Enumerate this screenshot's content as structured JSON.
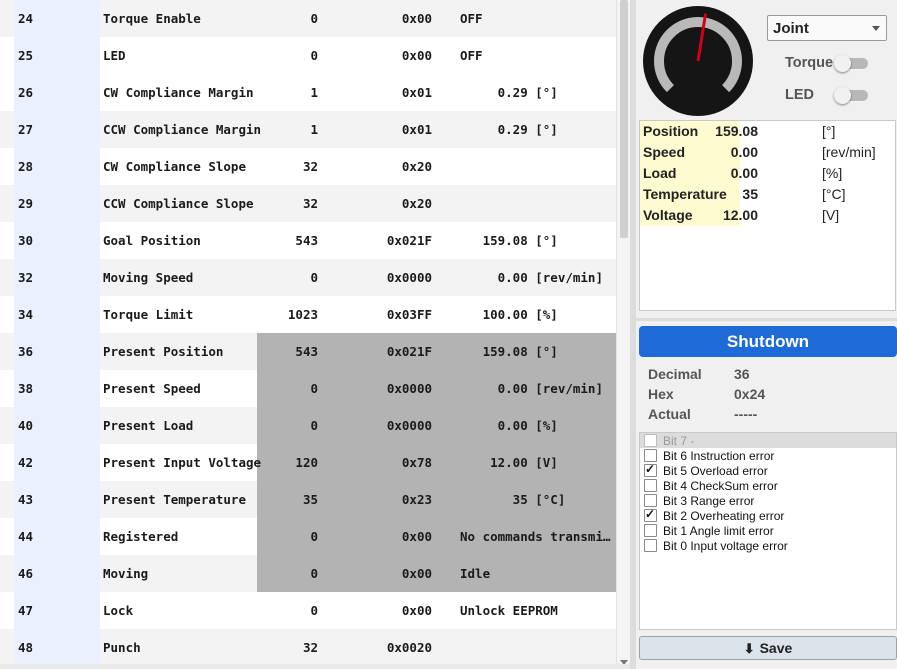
{
  "registers": [
    {
      "addr": "24",
      "name": "Torque Enable",
      "dec": "0",
      "hex": "0x00",
      "val": "OFF",
      "alt": true,
      "readonly": false
    },
    {
      "addr": "25",
      "name": "LED",
      "dec": "0",
      "hex": "0x00",
      "val": "OFF",
      "alt": false,
      "readonly": false
    },
    {
      "addr": "26",
      "name": "CW Compliance Margin",
      "dec": "1",
      "hex": "0x01",
      "val": "     0.29 [°]",
      "alt": false,
      "readonly": false
    },
    {
      "addr": "27",
      "name": "CCW Compliance Margin",
      "dec": "1",
      "hex": "0x01",
      "val": "     0.29 [°]",
      "alt": true,
      "readonly": false
    },
    {
      "addr": "28",
      "name": "CW Compliance Slope",
      "dec": "32",
      "hex": "0x20",
      "val": "",
      "alt": false,
      "readonly": false
    },
    {
      "addr": "29",
      "name": "CCW Compliance Slope",
      "dec": "32",
      "hex": "0x20",
      "val": "",
      "alt": true,
      "readonly": false
    },
    {
      "addr": "30",
      "name": "Goal Position",
      "dec": "543",
      "hex": "0x021F",
      "val": "   159.08 [°]",
      "alt": false,
      "readonly": false
    },
    {
      "addr": "32",
      "name": "Moving Speed",
      "dec": "0",
      "hex": "0x0000",
      "val": "     0.00 [rev/min]",
      "alt": true,
      "readonly": false
    },
    {
      "addr": "34",
      "name": "Torque Limit",
      "dec": "1023",
      "hex": "0x03FF",
      "val": "   100.00 [%]",
      "alt": false,
      "readonly": false
    },
    {
      "addr": "36",
      "name": "Present Position",
      "dec": "543",
      "hex": "0x021F",
      "val": "   159.08 [°]",
      "alt": true,
      "readonly": true
    },
    {
      "addr": "38",
      "name": "Present Speed",
      "dec": "0",
      "hex": "0x0000",
      "val": "     0.00 [rev/min]",
      "alt": false,
      "readonly": true
    },
    {
      "addr": "40",
      "name": "Present Load",
      "dec": "0",
      "hex": "0x0000",
      "val": "     0.00 [%]",
      "alt": true,
      "readonly": true
    },
    {
      "addr": "42",
      "name": "Present Input Voltage",
      "dec": "120",
      "hex": "0x78",
      "val": "    12.00 [V]",
      "alt": false,
      "readonly": true
    },
    {
      "addr": "43",
      "name": "Present Temperature",
      "dec": "35",
      "hex": "0x23",
      "val": "       35 [°C]",
      "alt": true,
      "readonly": true
    },
    {
      "addr": "44",
      "name": "Registered",
      "dec": "0",
      "hex": "0x00",
      "val": "No commands transmitted",
      "alt": false,
      "readonly": true
    },
    {
      "addr": "46",
      "name": "Moving",
      "dec": "0",
      "hex": "0x00",
      "val": "Idle",
      "alt": true,
      "readonly": true
    },
    {
      "addr": "47",
      "name": "Lock",
      "dec": "0",
      "hex": "0x00",
      "val": "Unlock EEPROM",
      "alt": false,
      "readonly": false
    },
    {
      "addr": "48",
      "name": "Punch",
      "dec": "32",
      "hex": "0x0020",
      "val": "",
      "alt": true,
      "readonly": false
    }
  ],
  "dial": {
    "angle_deg": 159.08,
    "needle_color": "#d0021b"
  },
  "mode_select": {
    "value": "Joint"
  },
  "toggles": {
    "torque": {
      "label": "Torque",
      "on": false
    },
    "led": {
      "label": "LED",
      "on": false
    }
  },
  "status": [
    {
      "key": "Position",
      "value": "159.08",
      "unit": "[°]"
    },
    {
      "key": "Speed",
      "value": "0.00",
      "unit": "[rev/min]"
    },
    {
      "key": "Load",
      "value": "0.00",
      "unit": "[%]"
    },
    {
      "key": "Temperature",
      "value": "35",
      "unit": "[°C]"
    },
    {
      "key": "Voltage",
      "value": "12.00",
      "unit": "[V]"
    }
  ],
  "shutdown": {
    "title": "Shutdown",
    "decimal_label": "Decimal",
    "decimal_value": "36",
    "hex_label": "Hex",
    "hex_value": "0x24",
    "actual_label": "Actual",
    "actual_value": "-----"
  },
  "bits": [
    {
      "label": "Bit 7 -",
      "checked": false,
      "faded": true
    },
    {
      "label": "Bit 6 Instruction error",
      "checked": false,
      "faded": false
    },
    {
      "label": "Bit 5 Overload error",
      "checked": true,
      "faded": false
    },
    {
      "label": "Bit 4 CheckSum error",
      "checked": false,
      "faded": false
    },
    {
      "label": "Bit 3 Range error",
      "checked": false,
      "faded": false
    },
    {
      "label": "Bit 2 Overheating error",
      "checked": true,
      "faded": false
    },
    {
      "label": "Bit 1 Angle limit error",
      "checked": false,
      "faded": false
    },
    {
      "label": "Bit 0 Input voltage error",
      "checked": false,
      "faded": false
    }
  ],
  "save": {
    "label": "Save",
    "icon": "download-icon"
  },
  "colors": {
    "accent": "#1e6ad6",
    "readonly_bg": "#b3b3b3",
    "status_key_bg": "#fdfbcf"
  }
}
